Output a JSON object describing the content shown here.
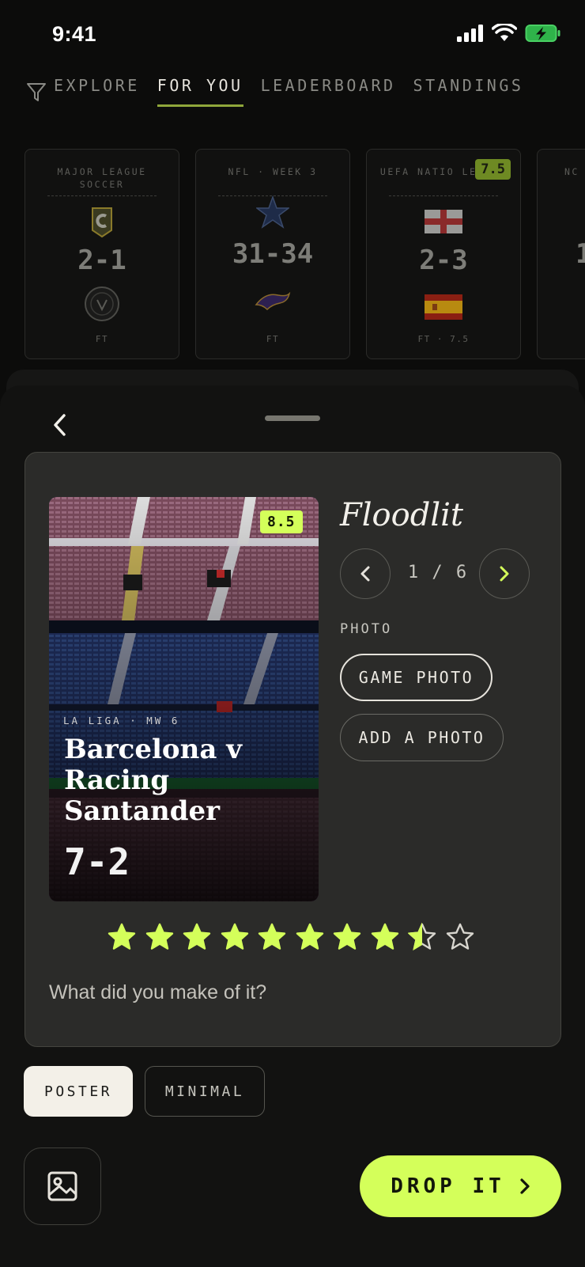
{
  "status_bar": {
    "time": "9:41"
  },
  "nav": {
    "tabs": [
      {
        "label": "EXPLORE",
        "active": false
      },
      {
        "label": "FOR YOU",
        "active": true
      },
      {
        "label": "LEADERBOARD",
        "active": false
      },
      {
        "label": "STANDINGS",
        "active": false
      }
    ]
  },
  "score_cards": [
    {
      "league": "MAJOR LEAGUE SOCCER",
      "score": "2-1",
      "status": "FT",
      "home_icon": "crew-crest-icon",
      "away_icon": "inter-miami-crest-icon"
    },
    {
      "league": "NFL · WEEK 3",
      "score": "31-34",
      "status": "FT",
      "home_icon": "star-logo-icon",
      "away_icon": "raven-logo-icon"
    },
    {
      "league": "UEFA NATIO LEAGUE",
      "score": "2-3",
      "status": "FT · 7.5",
      "rating": "7.5",
      "home_icon": "england-flag-icon",
      "away_icon": "spain-flag-icon"
    },
    {
      "league": "NC",
      "score": "1",
      "status": ""
    }
  ],
  "review": {
    "style_name": "Floodlit",
    "pager": "1 / 6",
    "photo_label": "PHOTO",
    "game_photo_label": "GAME PHOTO",
    "add_photo_label": "ADD A PHOTO",
    "poster": {
      "rating": "8.5",
      "league": "LA LIGA · MW 6",
      "title": "Barcelona v Racing Santander",
      "score": "7-2"
    },
    "stars": {
      "total": 10,
      "rating": 8.5
    },
    "prompt": "What did you make of it?"
  },
  "templates": {
    "poster_label": "POSTER",
    "minimal_label": "MINIMAL",
    "selected": "POSTER"
  },
  "actions": {
    "drop_label": "DROP IT"
  },
  "colors": {
    "accent": "#d4ff5a",
    "panel": "#2b2b29",
    "background": "#0c0c0b",
    "tab_underline": "#8fa63a"
  }
}
